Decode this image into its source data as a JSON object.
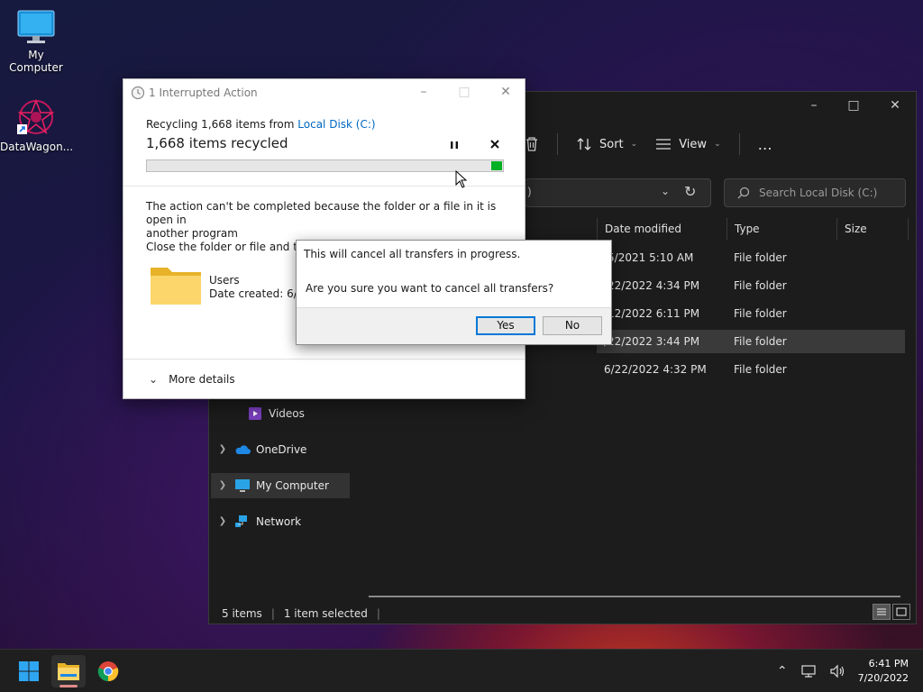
{
  "desktop": {
    "icons": [
      {
        "label": "My Computer"
      },
      {
        "label": "DataWagon..."
      }
    ]
  },
  "explorer": {
    "toolbar": {
      "sort_label": "Sort",
      "view_label": "View",
      "more_label": "…"
    },
    "address": {
      "visible_fragment": ")"
    },
    "search": {
      "placeholder": "Search Local Disk (C:)"
    },
    "columns": {
      "date": "Date modified",
      "type": "Type",
      "size": "Size"
    },
    "rows": [
      {
        "date": "/5/2021 5:10 AM",
        "type": "File folder",
        "selected": false
      },
      {
        "date": "/22/2022 4:34 PM",
        "type": "File folder",
        "selected": false
      },
      {
        "date": "/12/2022 6:11 PM",
        "type": "File folder",
        "selected": false
      },
      {
        "date": "/22/2022 3:44 PM",
        "type": "File folder",
        "selected": true
      },
      {
        "date": "6/22/2022 4:32 PM",
        "type": "File folder",
        "selected": false
      }
    ],
    "nav": {
      "videos": "Videos",
      "onedrive": "OneDrive",
      "my_computer": "My Computer",
      "network": "Network"
    },
    "status": {
      "items": "5 items",
      "selected": "1 item selected"
    }
  },
  "interrupted": {
    "title": "1 Interrupted Action",
    "recycling_prefix": "Recycling 1,668 items from ",
    "recycling_link": "Local Disk (C:)",
    "count_text": "1,668 items recycled",
    "progress_percent": 3,
    "message_line1": "The action can't be completed because the folder or a file in it is open in",
    "message_line2": "another program",
    "close_prompt": "Close the folder or file and try a",
    "file_name": "Users",
    "file_date": "Date created: 6/5/2",
    "more_details": "More details"
  },
  "confirm": {
    "line1": "This will cancel all transfers in progress.",
    "line2": "Are you sure you want to cancel all transfers?",
    "yes_label": "Yes",
    "no_label": "No"
  },
  "taskbar": {
    "time": "6:41 PM",
    "date": "7/20/2022"
  },
  "colors": {
    "progress": "#06b025",
    "link": "#0067c0",
    "accent": "#0078d7"
  }
}
